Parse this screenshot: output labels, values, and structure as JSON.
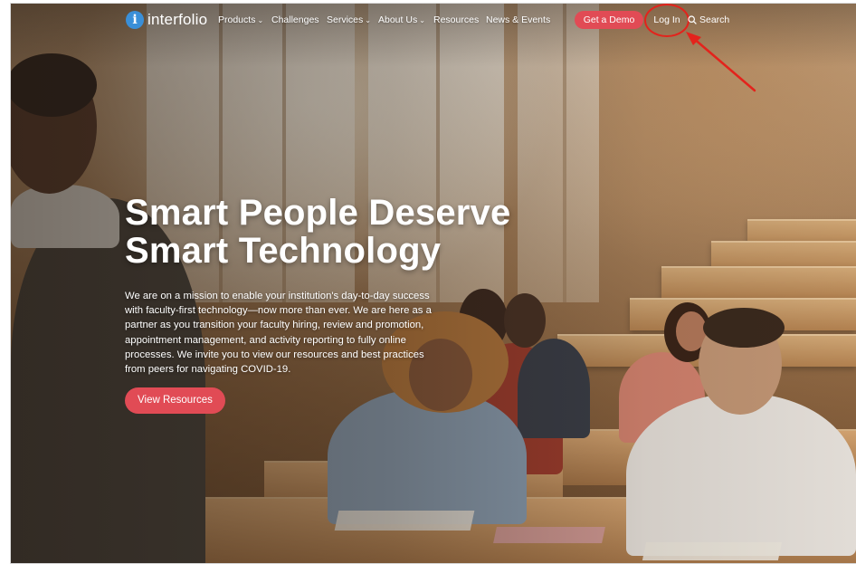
{
  "brand": {
    "name": "interfolio",
    "badge_letter": "i"
  },
  "nav": {
    "items": [
      {
        "label": "Products",
        "has_dropdown": true
      },
      {
        "label": "Challenges",
        "has_dropdown": false
      },
      {
        "label": "Services",
        "has_dropdown": true
      },
      {
        "label": "About Us",
        "has_dropdown": true
      },
      {
        "label": "Resources",
        "has_dropdown": false
      },
      {
        "label": "News & Events",
        "has_dropdown": false
      }
    ],
    "demo_label": "Get a Demo",
    "login_label": "Log In",
    "search_label": "Search"
  },
  "hero": {
    "title_line1": "Smart People Deserve",
    "title_line2": "Smart Technology",
    "body": "We are on a mission to enable your institution's day-to-day success with faculty-first technology—now more than ever. We are here as a partner as you transition your faculty hiring, review and promotion, appointment management, and activity reporting to fully online processes. We invite you to view our resources and best practices from peers for navigating COVID-19.",
    "cta_label": "View Resources"
  },
  "colors": {
    "accent": "#e14b55",
    "logo_blue": "#3a8fd8",
    "annotation_red": "#e3231c",
    "text": "#ffffff"
  },
  "icons": {
    "search": "magnifier-icon",
    "dropdown": "chevron-down-icon",
    "annotation": "arrow-icon"
  }
}
